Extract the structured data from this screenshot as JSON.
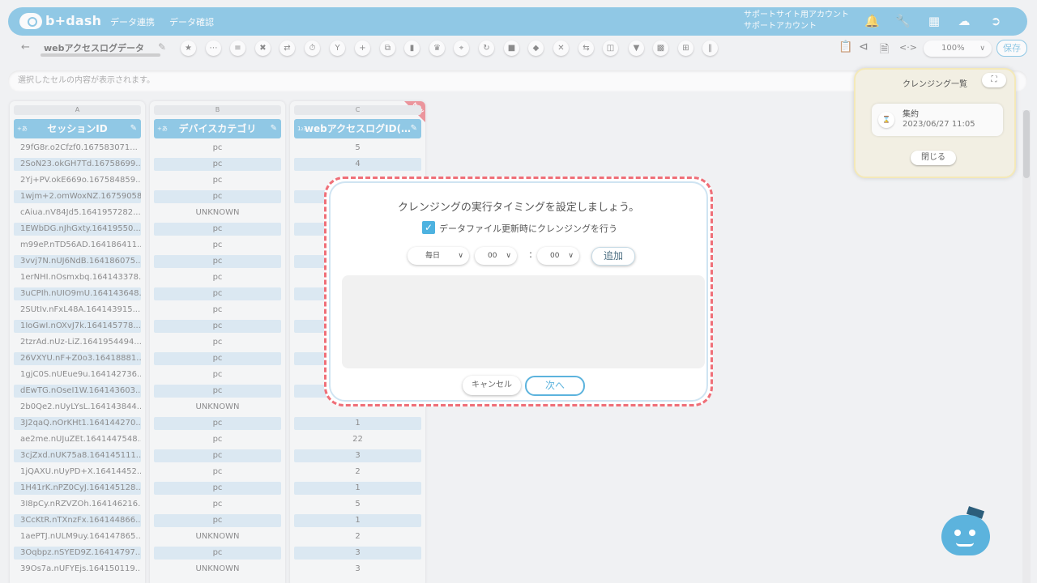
{
  "app": {
    "logo": "b+dash"
  },
  "nav": {
    "items": [
      "データ連携",
      "データ確認"
    ]
  },
  "account": {
    "line1": "サポートサイト用アカウント",
    "line2": "サポートアカウント"
  },
  "toolbar": {
    "dataset_name": "webアクセスログデータ",
    "zoom": "100%",
    "save_label": "保存"
  },
  "cellbar": {
    "placeholder": "選択したセルの内容が表示されます。"
  },
  "columns": [
    {
      "letter": "A",
      "name": "セッションID",
      "type": "+あ"
    },
    {
      "letter": "B",
      "name": "デバイスカテゴリ",
      "type": "+あ"
    },
    {
      "letter": "C",
      "name": "webアクセスログID(…",
      "type": "1₂3",
      "badge": "NEW"
    }
  ],
  "rows": [
    [
      "29fG8r.o2Cfzf0.167583071...",
      "pc",
      "5"
    ],
    [
      "2SoN23.okGH7Td.16758699...",
      "pc",
      "4"
    ],
    [
      "2Yj+PV.okE669o.167584859...",
      "pc",
      ""
    ],
    [
      "1wjm+2.omWoxNZ.16759058...",
      "pc",
      ""
    ],
    [
      "cAiua.nV84Jd5.1641957282...",
      "UNKNOWN",
      ""
    ],
    [
      "1EWbDG.nJhGxty.16419550...",
      "pc",
      ""
    ],
    [
      "m99eP.nTD56AD.164186411...",
      "pc",
      ""
    ],
    [
      "3vvj7N.nUJ6NdB.164186075...",
      "pc",
      ""
    ],
    [
      "1erNHI.nOsmxbq.164143378...",
      "pc",
      ""
    ],
    [
      "3uCPIh.nUIO9mU.164143648...",
      "pc",
      ""
    ],
    [
      "2SUtIv.nFxL48A.164143915...",
      "pc",
      ""
    ],
    [
      "1IoGwI.nOXvJ7k.164145778...",
      "pc",
      ""
    ],
    [
      "2tzrAd.nUz-LiZ.1641954494...",
      "pc",
      ""
    ],
    [
      "26VXYU.nF+Z0o3.16418881...",
      "pc",
      ""
    ],
    [
      "1gjC0S.nUEue9u.164142736...",
      "pc",
      ""
    ],
    [
      "dEwTG.nOseI1W.164143603...",
      "pc",
      ""
    ],
    [
      "2b0Qe2.nUyLYsL.164143844...",
      "UNKNOWN",
      ""
    ],
    [
      "3J2qaQ.nOrKHt1.164144270...",
      "pc",
      "1"
    ],
    [
      "ae2me.nUJuZEt.1641447548...",
      "pc",
      "22"
    ],
    [
      "3cjZxd.nUK75a8.164145111...",
      "pc",
      "3"
    ],
    [
      "1jQAXU.nUyPD+X.16414452...",
      "pc",
      "2"
    ],
    [
      "1H41rK.nPZ0CyJ.164145128...",
      "pc",
      "1"
    ],
    [
      "3I8pCy.nRZVZOh.164146216...",
      "pc",
      "5"
    ],
    [
      "3CcKtR.nTXnzFx.164144866...",
      "pc",
      "1"
    ],
    [
      "1aePTJ.nULM9uy.164147865...",
      "UNKNOWN",
      "2"
    ],
    [
      "3Oqbpz.nSYED9Z.16414797...",
      "pc",
      "3"
    ],
    [
      "39Os7a.nUFYEjs.164150119...",
      "UNKNOWN",
      "3"
    ]
  ],
  "panel": {
    "title": "クレンジング一覧",
    "card_name": "集約",
    "card_date": "2023/06/27 11:05",
    "close_label": "閉じる"
  },
  "modal": {
    "title": "クレンジングの実行タイミングを設定しましょう。",
    "checkbox_label": "データファイル更新時にクレンジングを行う",
    "checkbox_checked": true,
    "freq_value": "毎日",
    "hour_value": "00",
    "minute_value": "00",
    "colon": ":",
    "add_label": "追加",
    "cancel_label": "キャンセル",
    "next_label": "次へ"
  },
  "colors": {
    "accent": "#5cb3dd",
    "highlight_border": "#ef6f78",
    "panel_bg": "#f2efe3"
  }
}
